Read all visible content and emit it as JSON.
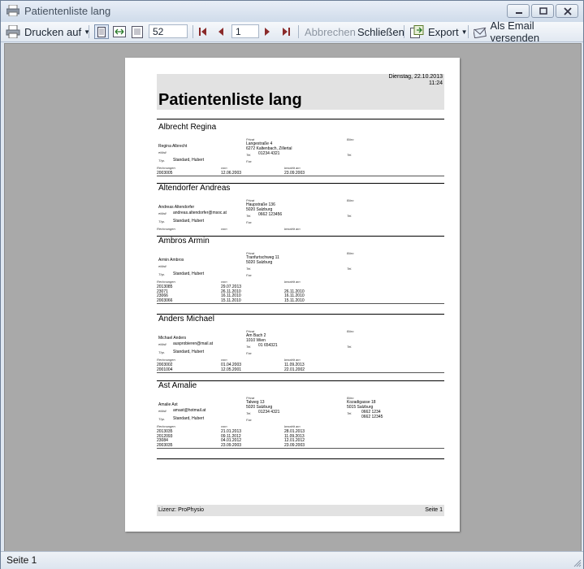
{
  "window": {
    "title": "Patientenliste lang"
  },
  "toolbar": {
    "print_label": "Drucken auf",
    "zoom_value": "52",
    "page_value": "1",
    "cancel_label": "Abbrechen",
    "close_label": "Schließen",
    "export_label": "Export",
    "email_label": "Als Email versenden"
  },
  "report": {
    "date": "Dienstag, 22.10.2013",
    "time": "11:24",
    "title": "Patientenliste lang",
    "footer_left": "Lizenz: ProPhysio",
    "footer_right": "Seite 1",
    "labels": {
      "privat": "Privat",
      "buero": "Büro",
      "email": "eMail",
      "tel": "Tel.",
      "fax": "Fax",
      "thp": "Thp.",
      "rechnungen": "Rechnungen",
      "vom": "vom",
      "bezahlt": "bezahlt am"
    },
    "patients": [
      {
        "name": "Albrecht Regina",
        "full": "Regina Albrecht",
        "email": "",
        "therapist": "Standard, Hubert",
        "street": "Langestraße 4",
        "city": "6272 Kaltenbach, Zillertal",
        "tel": "01234 4321",
        "work_street": "",
        "work_city": "",
        "work_tel": "",
        "invoices": [
          {
            "nr": "2003005",
            "date": "12.06.2003",
            "paid": "23.09.2003"
          }
        ]
      },
      {
        "name": "Altendorfer Andreas",
        "full": "Andreas Altendorfer",
        "email": "andreas.altendorfer@msoc.at",
        "therapist": "Standard, Hubert",
        "street": "Haupstraße 136",
        "city": "5020 Salzburg",
        "tel": "0662 123456",
        "work_street": "",
        "work_city": "",
        "work_tel": "",
        "invoices": []
      },
      {
        "name": "Ambros Armin",
        "full": "Armin Ambros",
        "email": "",
        "therapist": "Standard, Hubert",
        "street": "Tranfurtschweg 11",
        "city": "5020 Salzburg",
        "tel": "",
        "work_street": "",
        "work_city": "",
        "work_tel": "",
        "invoices": [
          {
            "nr": "2013085",
            "date": "29.07.2013",
            "paid": ""
          },
          {
            "nr": "23071",
            "date": "26.11.2010",
            "paid": "26.11.2010"
          },
          {
            "nr": "23066",
            "date": "16.11.2010",
            "paid": "16.11.2010"
          },
          {
            "nr": "2003066",
            "date": "15.11.2010",
            "paid": "15.11.2010"
          }
        ]
      },
      {
        "name": "Anders Michael",
        "full": "Michael Anders",
        "email": "ausprobieren@mail.at",
        "therapist": "Standard, Hubert",
        "street": "Am Bach 2",
        "city": "1010 Wien",
        "tel": "01 654321",
        "work_street": "",
        "work_city": "",
        "work_tel": "",
        "invoices": [
          {
            "nr": "2003002",
            "date": "01.04.2003",
            "paid": "11.09.2013"
          },
          {
            "nr": "2001004",
            "date": "12.05.2001",
            "paid": "22.01.2002"
          }
        ]
      },
      {
        "name": "Ast Amalie",
        "full": "Amalie Ast",
        "email": "amast@hotmail.at",
        "therapist": "Standard, Hubert",
        "street": "Talweg 13",
        "city": "5020 Salzburg",
        "tel": "01234 4321",
        "work_street": "Kozadigasse 18",
        "work_city": "5015 Salzburg",
        "work_tel": "0662 1234",
        "work_fax": "0662 12345",
        "invoices": [
          {
            "nr": "2013035",
            "date": "21.01.2013",
            "paid": "28.01.2013"
          },
          {
            "nr": "2012093",
            "date": "09.11.2012",
            "paid": "11.09.2013"
          },
          {
            "nr": "23084",
            "date": "04.01.2012",
            "paid": "12.01.2012"
          },
          {
            "nr": "2003035",
            "date": "23.09.2003",
            "paid": "23.09.2003"
          }
        ]
      }
    ]
  },
  "status": {
    "text": "Seite 1"
  }
}
